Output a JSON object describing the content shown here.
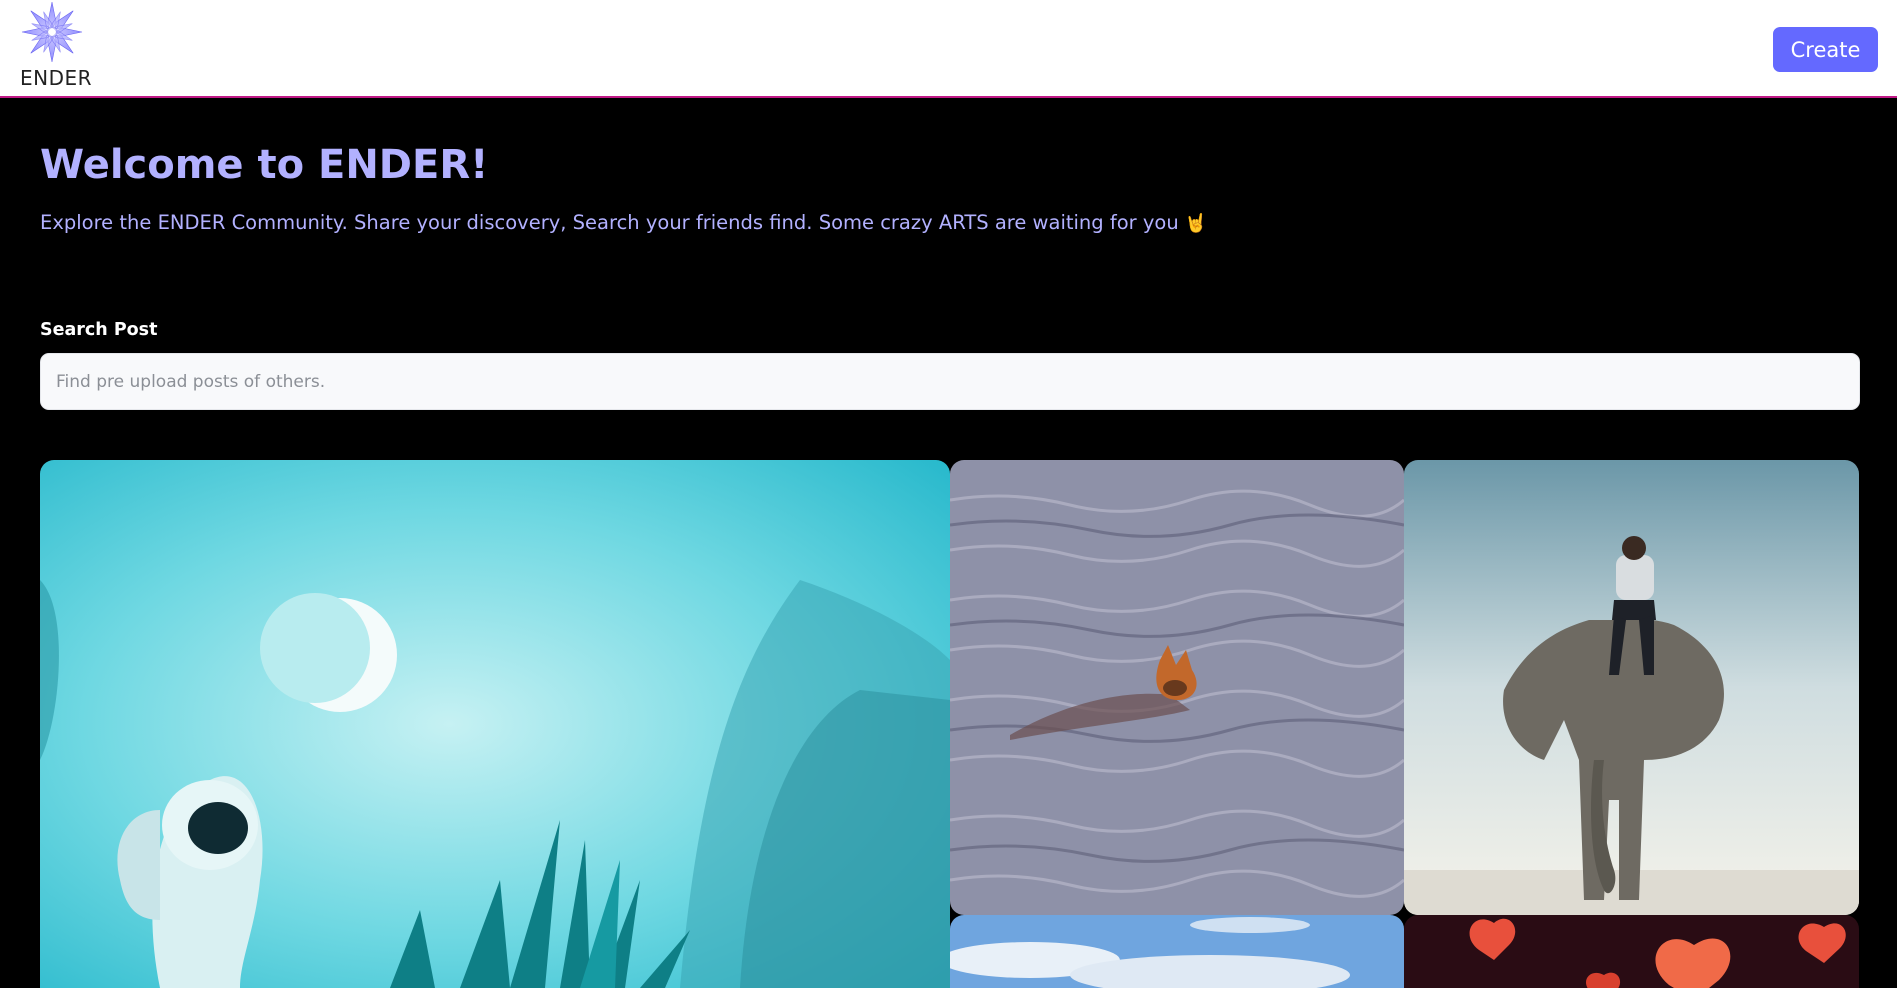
{
  "header": {
    "logo_text": "ENDER",
    "create_label": "Create",
    "brand_color": "#6469ff",
    "logo_icon": "flower-icon"
  },
  "hero": {
    "title": "Welcome to ENDER!",
    "subtitle": "Explore the ENDER Community. Share your discovery, Search your friends find. Some crazy ARTS are waiting for you",
    "subtitle_emoji": "🤘",
    "accent_color": "#b2b1ff"
  },
  "search": {
    "label": "Search Post",
    "placeholder": "Find pre upload posts of others.",
    "value": ""
  },
  "gallery": {
    "posts": [
      {
        "subject": "astronaut-moon-plants"
      },
      {
        "subject": "fox-swimming-water"
      },
      {
        "subject": "man-sitting-on-elephant"
      },
      {
        "subject": "blue-sky-clouds"
      },
      {
        "subject": "red-hearts"
      }
    ]
  }
}
